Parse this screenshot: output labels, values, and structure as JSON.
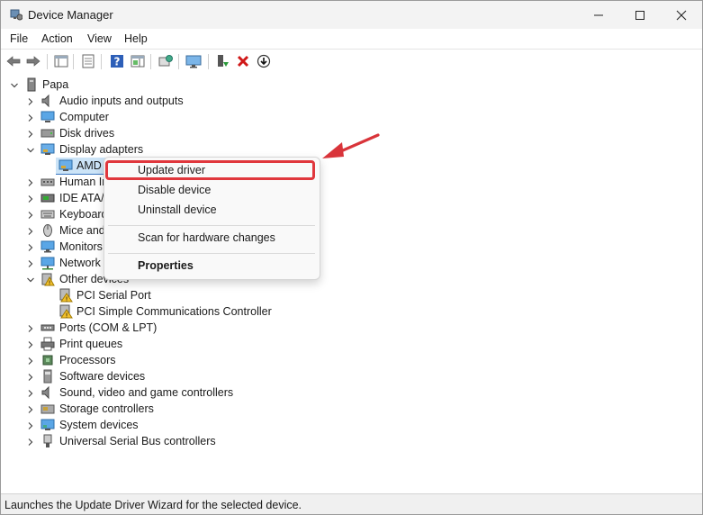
{
  "window": {
    "title": "Device Manager",
    "controls": [
      "minimize",
      "maximize",
      "close"
    ]
  },
  "menu": {
    "items": [
      "File",
      "Action",
      "View",
      "Help"
    ]
  },
  "toolbar": {
    "icons": [
      "back-icon",
      "forward-icon",
      "show-hide-console-tree-icon",
      "properties-icon",
      "help-icon",
      "action-pane-icon",
      "update-driver-icon",
      "monitor-icon",
      "enable-device-icon",
      "uninstall-icon",
      "download-icon"
    ]
  },
  "tree": {
    "root": "Papa",
    "items": [
      {
        "label": "Audio inputs and outputs",
        "icon": "speaker-icon",
        "expanded": false
      },
      {
        "label": "Computer",
        "icon": "computer-icon",
        "expanded": false
      },
      {
        "label": "Disk drives",
        "icon": "disk-icon",
        "expanded": false
      },
      {
        "label": "Display adapters",
        "icon": "display-icon",
        "expanded": true
      },
      {
        "label": "AMD",
        "icon": "display-icon",
        "child": true,
        "selected": true
      },
      {
        "label": "Human Ir",
        "icon": "hid-icon",
        "expanded": false
      },
      {
        "label": "IDE ATA/A",
        "icon": "ide-icon",
        "expanded": false
      },
      {
        "label": "Keyboard",
        "icon": "keyboard-icon",
        "expanded": false
      },
      {
        "label": "Mice and",
        "icon": "mouse-icon",
        "expanded": false
      },
      {
        "label": "Monitors",
        "icon": "monitor-icon",
        "expanded": false
      },
      {
        "label": "Network a",
        "icon": "network-icon",
        "expanded": false
      },
      {
        "label": "Other devices",
        "icon": "other-devices-icon",
        "expanded": true
      },
      {
        "label": "PCI Serial Port",
        "icon": "warning-device-icon",
        "child": true
      },
      {
        "label": "PCI Simple Communications Controller",
        "icon": "warning-device-icon",
        "child": true
      },
      {
        "label": "Ports (COM & LPT)",
        "icon": "port-icon",
        "expanded": false
      },
      {
        "label": "Print queues",
        "icon": "printer-icon",
        "expanded": false
      },
      {
        "label": "Processors",
        "icon": "cpu-icon",
        "expanded": false
      },
      {
        "label": "Software devices",
        "icon": "software-icon",
        "expanded": false
      },
      {
        "label": "Sound, video and game controllers",
        "icon": "speaker-icon",
        "expanded": false
      },
      {
        "label": "Storage controllers",
        "icon": "storage-icon",
        "expanded": false
      },
      {
        "label": "System devices",
        "icon": "system-icon",
        "expanded": false
      },
      {
        "label": "Universal Serial Bus controllers",
        "icon": "usb-icon",
        "expanded": false
      }
    ]
  },
  "context_menu": {
    "update": "Update driver",
    "disable": "Disable device",
    "uninstall": "Uninstall device",
    "scan": "Scan for hardware changes",
    "properties": "Properties"
  },
  "status": {
    "text": "Launches the Update Driver Wizard for the selected device."
  },
  "colors": {
    "highlight": "#e0373d",
    "selection": "#cce4f7",
    "accent": "#0067c0"
  }
}
